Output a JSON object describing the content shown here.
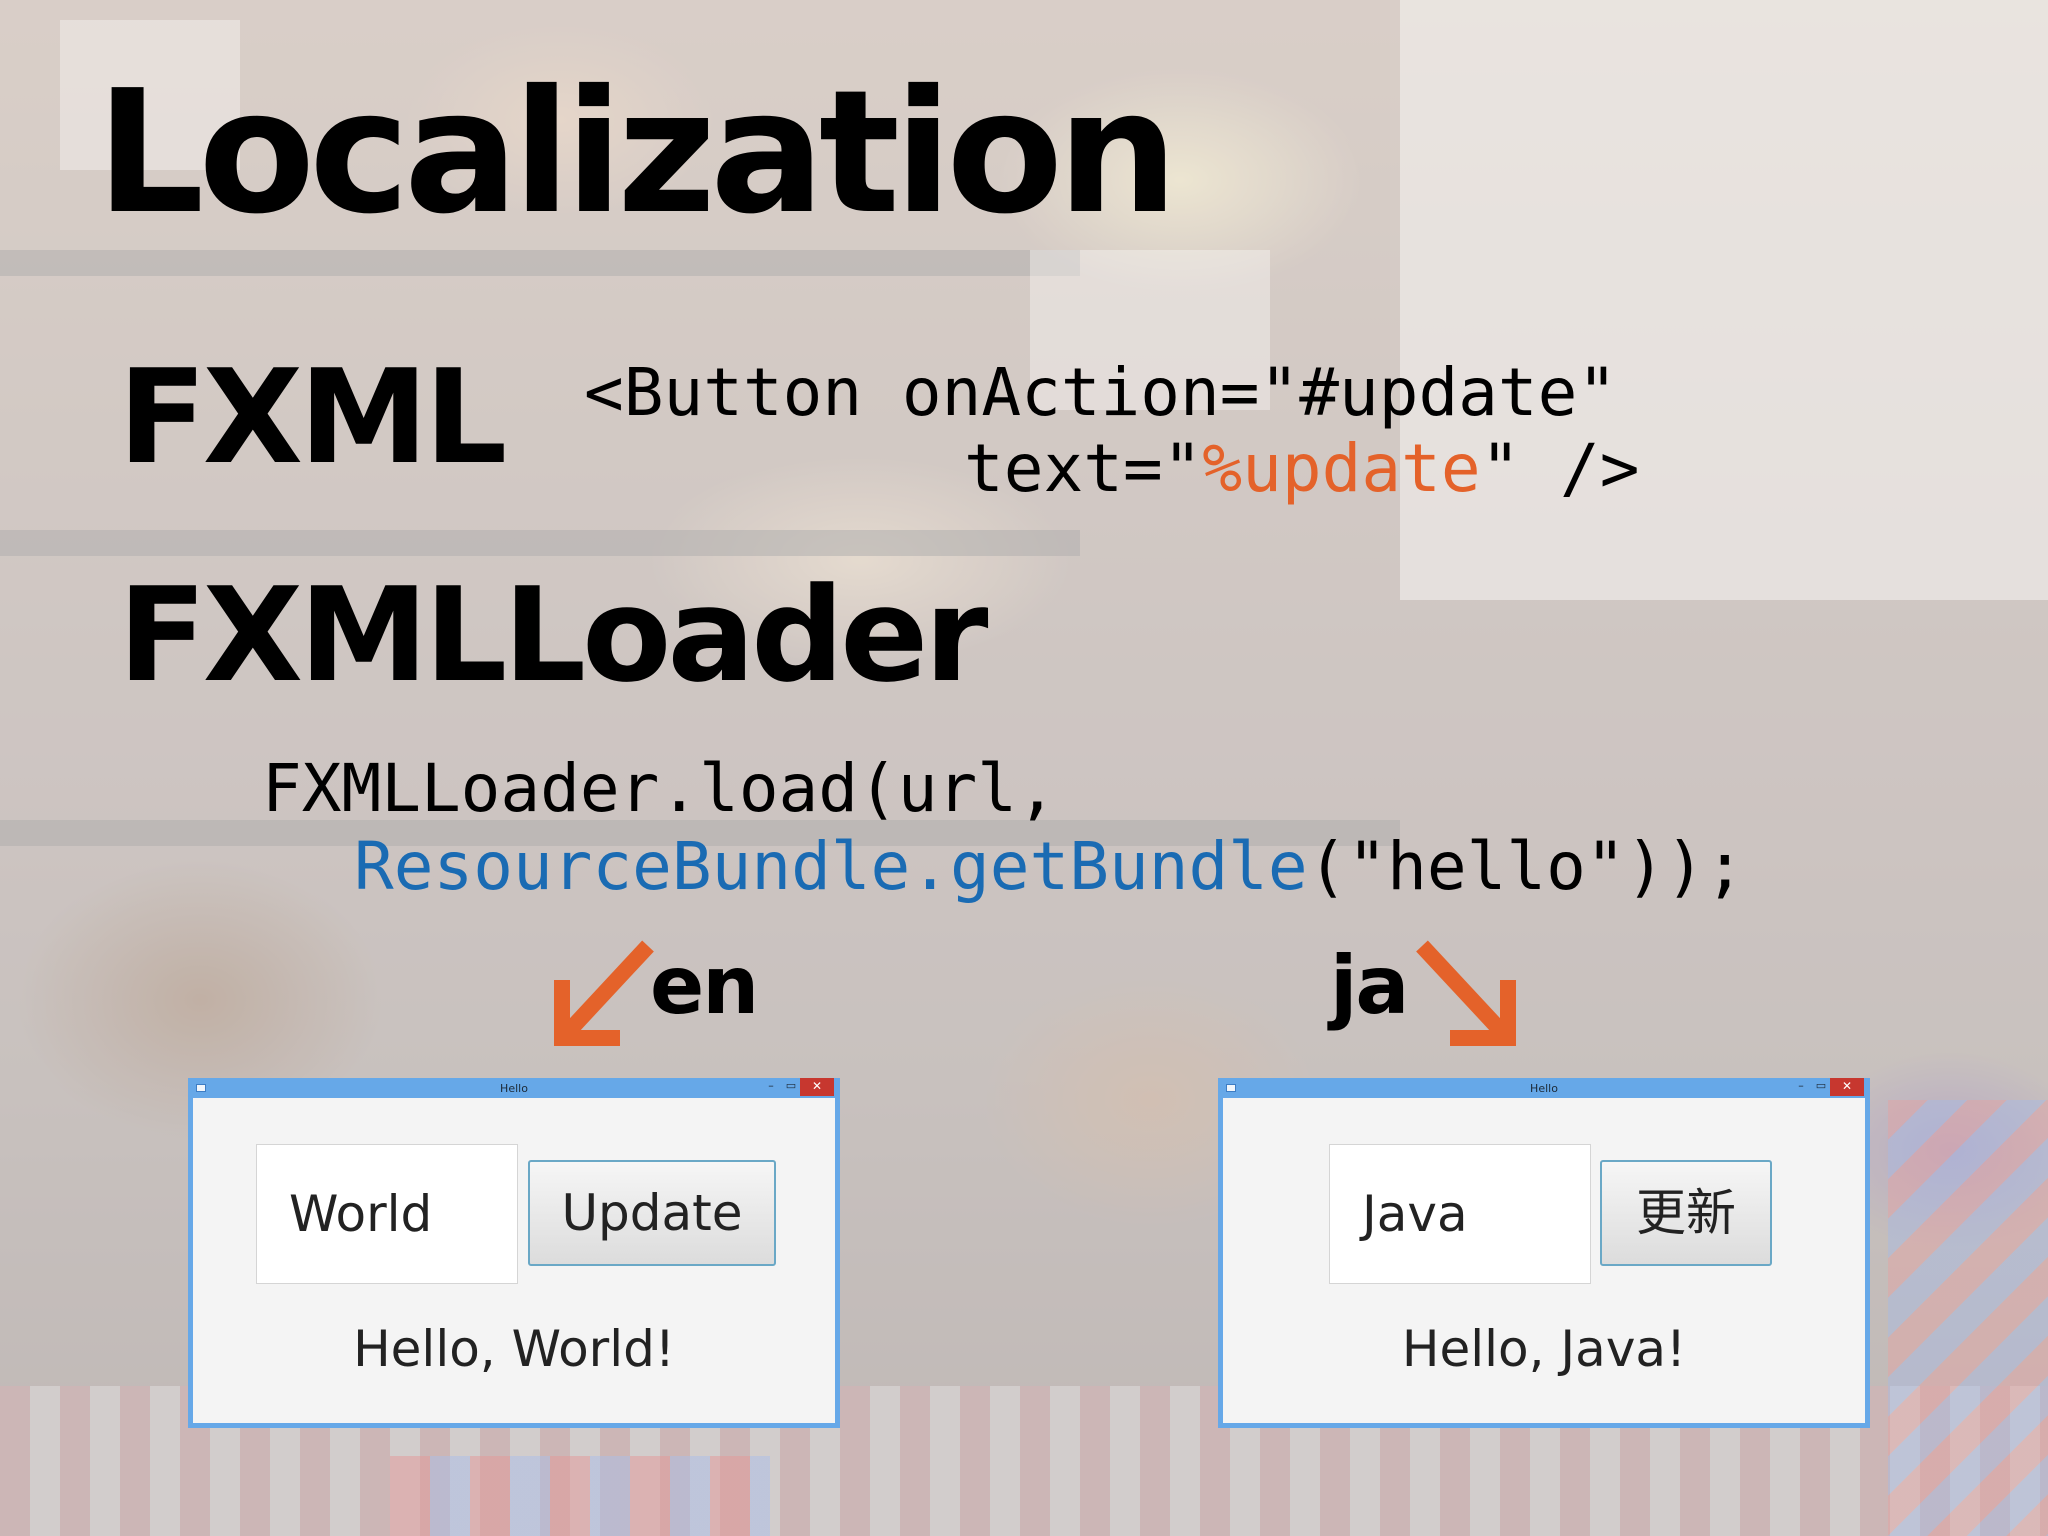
{
  "slide": {
    "title": "Localization",
    "fxml_heading": "FXML",
    "fxml_code": {
      "line1": "<Button onAction=\"#update\"",
      "line2_prefix": "text=\"",
      "line2_highlight": "%update",
      "line2_suffix": "\" />"
    },
    "loader_heading": "FXMLLoader",
    "loader_code": {
      "line1": "FXMLLoader.load(url,",
      "line2_highlight": "ResourceBundle.getBundle",
      "line2_suffix": "(\"hello\"));"
    },
    "label_en": "en",
    "label_ja": "ja"
  },
  "window_en": {
    "title": "Hello",
    "minimize": "–",
    "maximize": "▭",
    "close": "✕",
    "text_field_value": "World",
    "button_label": "Update",
    "output_label": "Hello, World!"
  },
  "window_ja": {
    "title": "Hello",
    "minimize": "–",
    "maximize": "▭",
    "close": "✕",
    "text_field_value": "Java",
    "button_label": "更新",
    "output_label": "Hello, Java!"
  },
  "colors": {
    "highlight_orange": "#e4622a",
    "highlight_blue": "#1a6bb3",
    "window_frame": "#66a8e8",
    "arrow": "#e4622a"
  }
}
